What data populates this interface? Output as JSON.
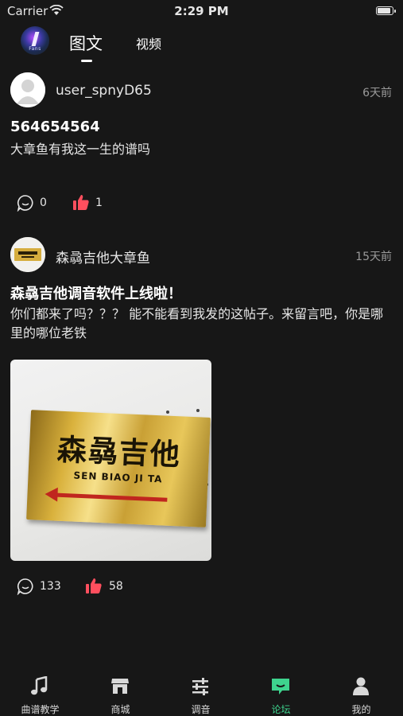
{
  "status_bar": {
    "carrier": "Carrier",
    "time": "2:29 PM"
  },
  "top_nav": {
    "avatar_text": "Fans",
    "tabs": [
      {
        "label": "图文",
        "active": true
      },
      {
        "label": "视频",
        "active": false
      }
    ]
  },
  "posts": [
    {
      "username": "user_spnyD65",
      "time": "6天前",
      "title": "564654564",
      "body": "大章鱼有我这一生的谱吗",
      "comments": "0",
      "likes": "1"
    },
    {
      "username": "森骉吉他大章鱼",
      "time": "15天前",
      "title": "森骉吉他调音软件上线啦！",
      "body": "你们都来了吗？？？ 能不能看到我发的这帖子。来留言吧，你是哪里的哪位老铁",
      "image": {
        "sign_cn": "森骉吉他",
        "sign_en": "SEN BIAO JI TA"
      },
      "comments": "133",
      "likes": "58"
    }
  ],
  "tab_bar": {
    "items": [
      {
        "label": "曲谱教学",
        "icon": "music-note-icon"
      },
      {
        "label": "商城",
        "icon": "shop-icon"
      },
      {
        "label": "调音",
        "icon": "sliders-icon"
      },
      {
        "label": "论坛",
        "icon": "forum-icon",
        "active": true
      },
      {
        "label": "我的",
        "icon": "person-icon"
      }
    ]
  },
  "colors": {
    "background": "#171717",
    "accent": "#3ed48e",
    "like": "#ff4f5e"
  }
}
